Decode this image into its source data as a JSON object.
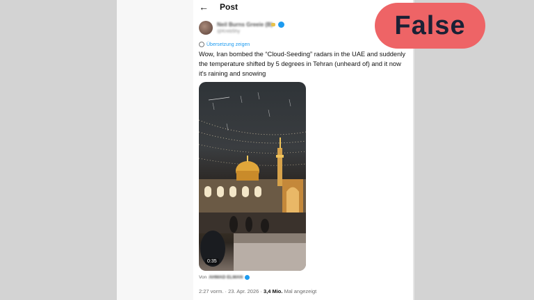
{
  "header": {
    "title": "Post",
    "back_icon": "arrow-left-icon"
  },
  "author": {
    "name": "Neil Burns Greeie (B)",
    "handle": "@Kreb5hy"
  },
  "translate_label": "Übersetzung zeigen",
  "tweet_text": "Wow, Iran bombed the “Cloud-Seeding” radars in the UAE and suddenly the temperature shifted by 5 degrees in Tehran (unheard of) and it now it's raining and snowing",
  "media": {
    "duration": "0:35"
  },
  "via": {
    "prefix": "Von",
    "name": "AHMAD ELMAN"
  },
  "meta": {
    "time": "2:27 vorm. · 23. Apr. 2026 · ",
    "views_count": "3,4 Mio.",
    "views_label": " Mal angezeigt"
  },
  "fact_check": {
    "verdict": "False",
    "color": "#ee6466"
  }
}
